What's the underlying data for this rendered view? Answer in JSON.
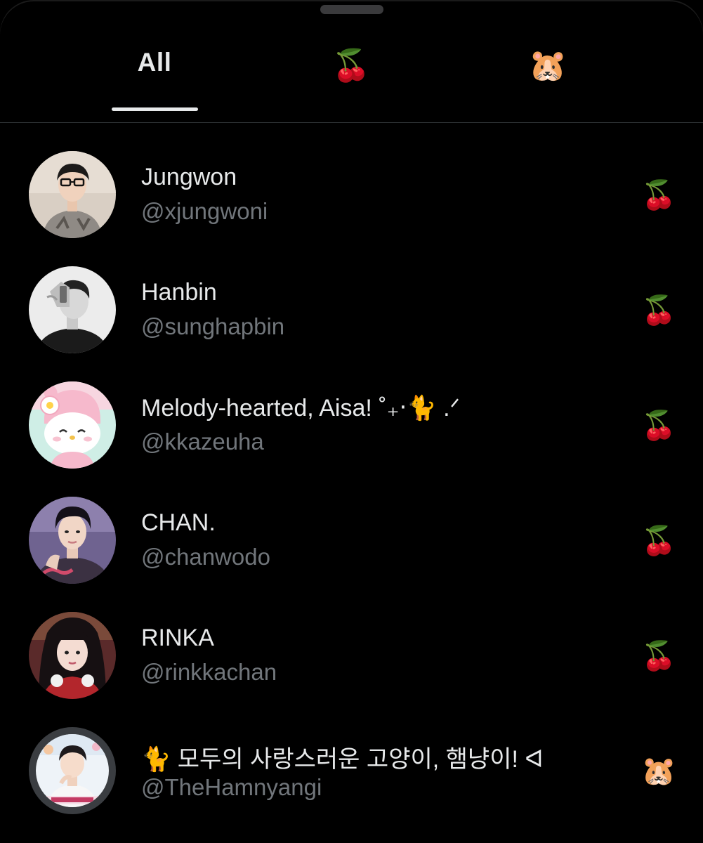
{
  "tabs": [
    {
      "label": "All",
      "emoji": ""
    },
    {
      "label": "",
      "emoji": "🍒"
    },
    {
      "label": "",
      "emoji": "🐹"
    }
  ],
  "active_tab": "All",
  "accounts": [
    {
      "name": "Jungwon",
      "handle": "@xjungwoni",
      "list_emoji": "🍒",
      "avatar": "photo-portrait-light"
    },
    {
      "name": "Hanbin",
      "handle": "@sunghapbin",
      "list_emoji": "🍒",
      "avatar": "photo-portrait-bw"
    },
    {
      "name": "Melody-hearted, Aisa! ˚₊‧🐈 .ᐟ",
      "handle": "@kkazeuha",
      "list_emoji": "🍒",
      "avatar": "my-melody-cartoon"
    },
    {
      "name": "CHAN.",
      "handle": "@chanwodo",
      "list_emoji": "🍒",
      "avatar": "photo-portrait-purple"
    },
    {
      "name": "RINKA",
      "handle": "@rinkkachan",
      "list_emoji": "🍒",
      "avatar": "photo-portrait-red"
    },
    {
      "name": "🐈 모두의 사랑스러운 고양이, 햄냥이! ᐊ",
      "handle": "@TheHamnyangi",
      "list_emoji": "🐹",
      "avatar": "photo-magazine-cover"
    }
  ],
  "colors": {
    "background": "#000000",
    "primary_text": "#e7e9ea",
    "secondary_text": "#71767b",
    "divider": "#2f3336"
  }
}
